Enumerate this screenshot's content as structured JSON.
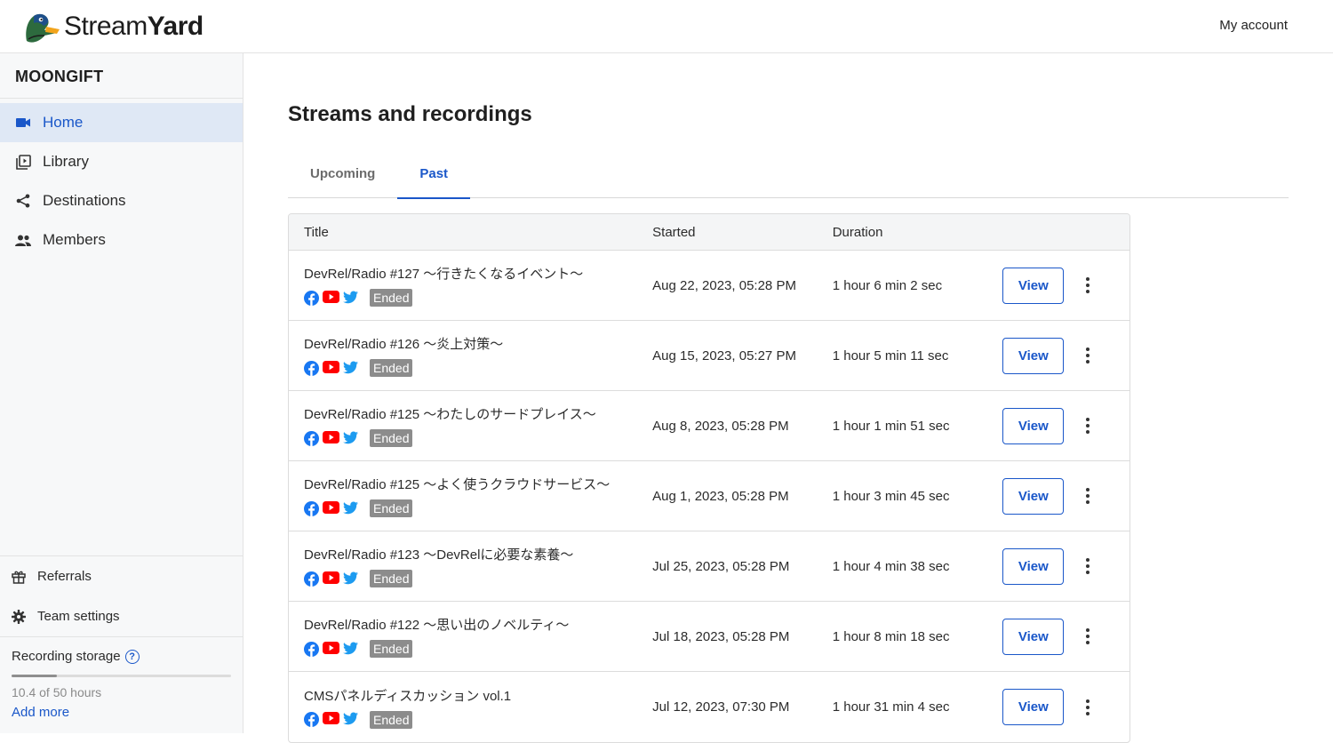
{
  "header": {
    "brand_light": "Stream",
    "brand_bold": "Yard",
    "my_account": "My account"
  },
  "sidebar": {
    "team_name": "MOONGIFT",
    "items": [
      {
        "label": "Home",
        "icon": "camera-icon",
        "active": true
      },
      {
        "label": "Library",
        "icon": "library-icon"
      },
      {
        "label": "Destinations",
        "icon": "share-icon"
      },
      {
        "label": "Members",
        "icon": "members-icon"
      }
    ],
    "bottom": [
      {
        "label": "Referrals",
        "icon": "gift-icon"
      },
      {
        "label": "Team settings",
        "icon": "gear-icon"
      }
    ],
    "storage": {
      "title": "Recording storage",
      "usage": "10.4 of 50 hours",
      "fraction": 0.208,
      "add_more": "Add more"
    }
  },
  "main": {
    "title": "Streams and recordings",
    "tabs": [
      {
        "label": "Upcoming",
        "active": false
      },
      {
        "label": "Past",
        "active": true
      }
    ],
    "columns": [
      "Title",
      "Started",
      "Duration"
    ],
    "status_label": "Ended",
    "view_label": "View",
    "rows": [
      {
        "title": "DevRel/Radio #127 〜行きたくなるイベント〜",
        "started": "Aug 22, 2023, 05:28 PM",
        "duration": "1 hour 6 min 2 sec"
      },
      {
        "title": "DevRel/Radio #126 〜炎上対策〜",
        "started": "Aug 15, 2023, 05:27 PM",
        "duration": "1 hour 5 min 11 sec"
      },
      {
        "title": "DevRel/Radio #125 〜わたしのサードプレイス〜",
        "started": "Aug 8, 2023, 05:28 PM",
        "duration": "1 hour 1 min 51 sec"
      },
      {
        "title": "DevRel/Radio #125 〜よく使うクラウドサービス〜",
        "started": "Aug 1, 2023, 05:28 PM",
        "duration": "1 hour 3 min 45 sec"
      },
      {
        "title": "DevRel/Radio #123 〜DevRelに必要な素養〜",
        "started": "Jul 25, 2023, 05:28 PM",
        "duration": "1 hour 4 min 38 sec"
      },
      {
        "title": "DevRel/Radio #122 〜思い出のノベルティ〜",
        "started": "Jul 18, 2023, 05:28 PM",
        "duration": "1 hour 8 min 18 sec"
      },
      {
        "title": "CMSパネルディスカッション vol.1",
        "started": "Jul 12, 2023, 07:30 PM",
        "duration": "1 hour 31 min 4 sec"
      }
    ],
    "platform_icons": [
      "facebook-icon",
      "youtube-icon",
      "twitter-icon"
    ],
    "colors": {
      "accent": "#1a57c9",
      "facebook": "#1877f2",
      "youtube": "#ff0000",
      "twitter": "#1d9bf0",
      "badge": "#8c8c8c"
    }
  }
}
